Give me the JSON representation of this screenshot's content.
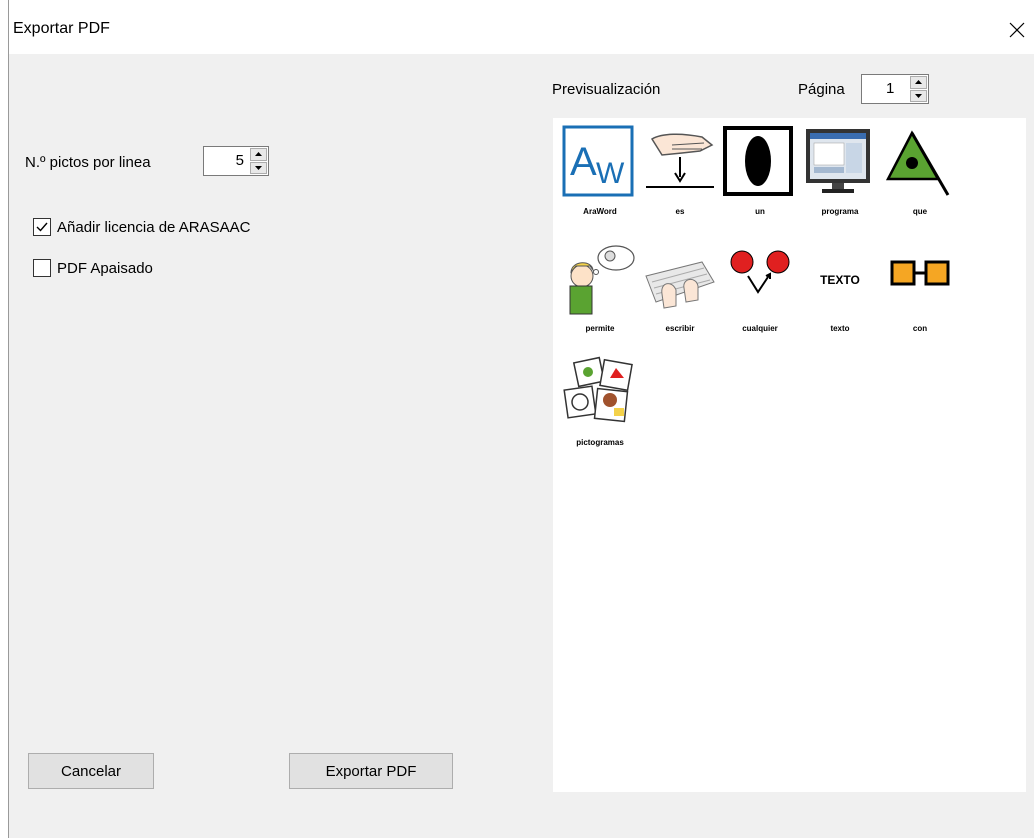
{
  "window": {
    "title": "Exportar PDF"
  },
  "settings": {
    "pictos_per_line_label": "N.º pictos por linea",
    "pictos_per_line_value": "5",
    "license_label": "Añadir licencia de ARASAAC",
    "license_checked": true,
    "landscape_label": "PDF Apaisado",
    "landscape_checked": false
  },
  "preview": {
    "title": "Previsualización",
    "page_label": "Página",
    "page_value": "1",
    "pictos": [
      {
        "caption": "AraWord",
        "icon": "araword-logo-icon"
      },
      {
        "caption": "es",
        "icon": "hand-pointing-down-icon"
      },
      {
        "caption": "un",
        "icon": "black-oval-icon"
      },
      {
        "caption": "programa",
        "icon": "computer-monitor-icon"
      },
      {
        "caption": "que",
        "icon": "triangle-dot-icon"
      },
      {
        "caption": "permite",
        "icon": "person-thinking-icon"
      },
      {
        "caption": "escribir",
        "icon": "keyboard-typing-icon"
      },
      {
        "caption": "cualquier",
        "icon": "red-circles-choice-icon"
      },
      {
        "caption": "texto",
        "icon": "text-word-icon",
        "text": "TEXTO"
      },
      {
        "caption": "con",
        "icon": "orange-squares-linked-icon"
      },
      {
        "caption": "pictogramas",
        "icon": "photos-collage-icon"
      }
    ]
  },
  "buttons": {
    "cancel": "Cancelar",
    "export": "Exportar PDF"
  },
  "colors": {
    "accent_blue": "#1a6fb5",
    "green": "#5aa331",
    "red": "#e02020",
    "orange": "#f5a623"
  }
}
